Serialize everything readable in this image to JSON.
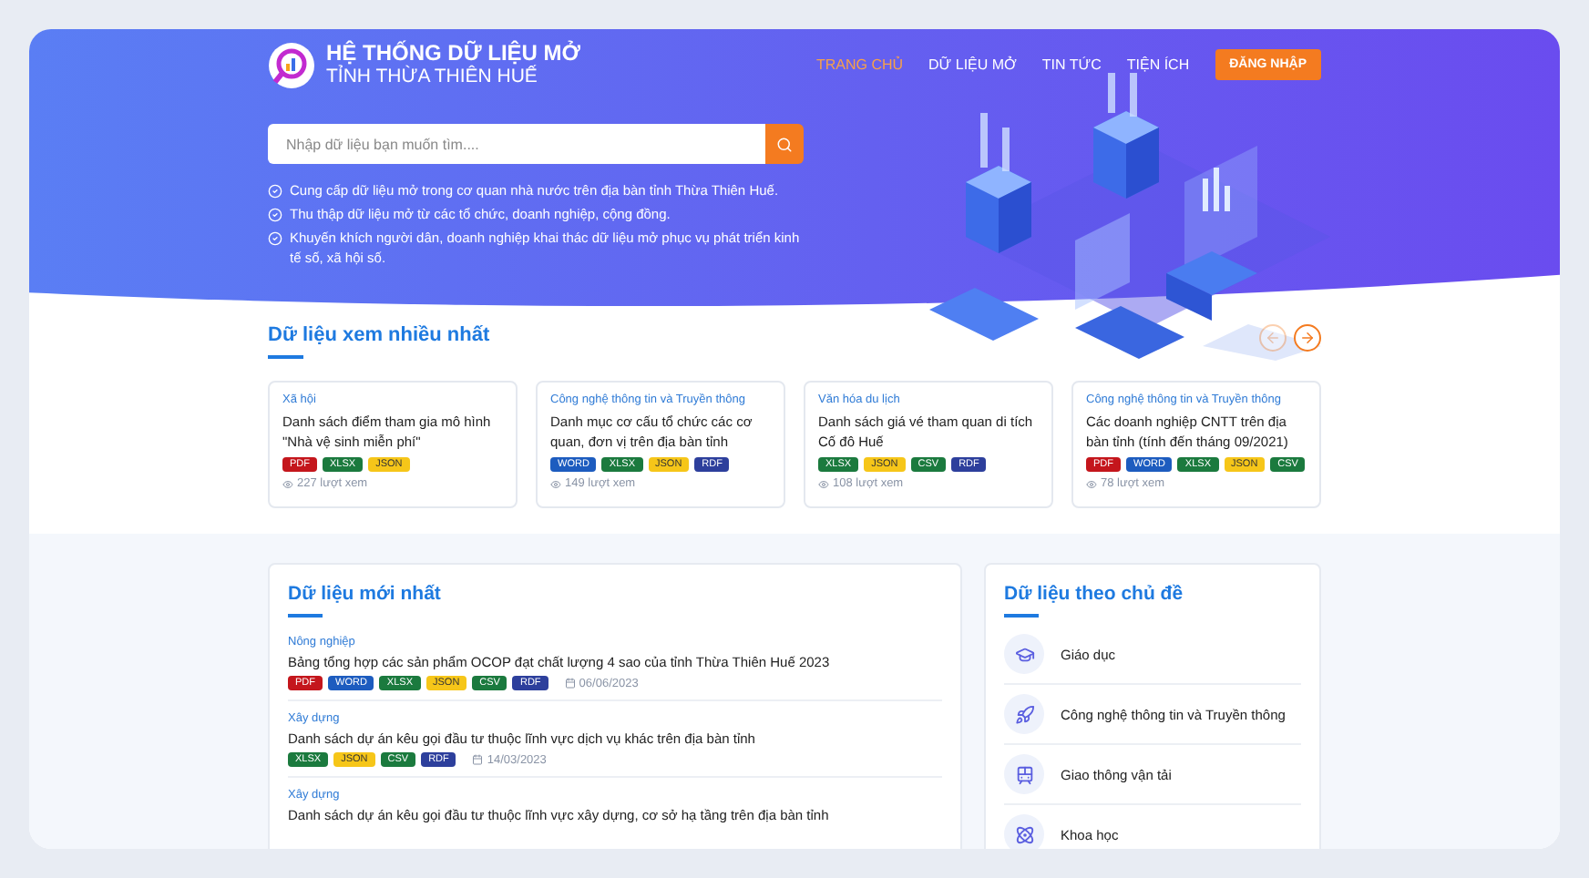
{
  "header": {
    "logo_title": "HỆ THỐNG DỮ LIỆU MỞ",
    "logo_subtitle": "TỈNH THỪA THIÊN HUẾ",
    "nav": [
      {
        "label": "TRANG CHỦ",
        "selected": true
      },
      {
        "label": "DỮ LIỆU MỞ",
        "selected": false
      },
      {
        "label": "TIN TỨC",
        "selected": false
      },
      {
        "label": "TIỆN ÍCH",
        "selected": false
      }
    ],
    "login_button": "ĐĂNG NHẬP"
  },
  "search": {
    "placeholder": "Nhập dữ liệu bạn muốn tìm...."
  },
  "bullets": [
    "Cung cấp dữ liệu mở trong cơ quan nhà nước trên địa bàn tỉnh Thừa Thiên Huế.",
    "Thu thập dữ liệu mở từ các tổ chức, doanh nghiệp, cộng đồng.",
    "Khuyến khích người dân, doanh nghiệp khai thác dữ liệu mở phục vụ phát triển kinh tế số, xã hội số."
  ],
  "most_viewed": {
    "title": "Dữ liệu xem nhiều nhất",
    "arrows": [
      {
        "kind": "prev",
        "disabled": true
      },
      {
        "kind": "next",
        "disabled": false
      }
    ],
    "cards": [
      {
        "category": "Xã hội",
        "title": "Danh sách điểm tham gia mô hình \"Nhà vệ sinh miễn phí\"",
        "tags": [
          {
            "label": "PDF",
            "color": "#c4161c"
          },
          {
            "label": "XLSX",
            "color": "#1b7a3e"
          },
          {
            "label": "JSON",
            "color": "#f6c619"
          }
        ],
        "views": "227 lượt xem"
      },
      {
        "category": "Công nghệ thông tin và Truyền thông",
        "title": "Danh mục cơ cấu tổ chức các cơ quan, đơn vị trên địa bàn tỉnh",
        "tags": [
          {
            "label": "WORD",
            "color": "#1d5cbf"
          },
          {
            "label": "XLSX",
            "color": "#1b7a3e"
          },
          {
            "label": "JSON",
            "color": "#f6c619"
          },
          {
            "label": "RDF",
            "color": "#2d3f9c"
          }
        ],
        "views": "149 lượt xem"
      },
      {
        "category": "Văn hóa du lịch",
        "title": "Danh sách giá vé tham quan di tích Cố đô Huế",
        "tags": [
          {
            "label": "XLSX",
            "color": "#1b7a3e"
          },
          {
            "label": "JSON",
            "color": "#f6c619"
          },
          {
            "label": "CSV",
            "color": "#1b7a3e"
          },
          {
            "label": "RDF",
            "color": "#2d3f9c"
          }
        ],
        "views": "108 lượt xem"
      },
      {
        "category": "Công nghệ thông tin và Truyền thông",
        "title": "Các doanh nghiệp CNTT trên địa bàn tỉnh (tính đến tháng 09/2021)",
        "tags": [
          {
            "label": "PDF",
            "color": "#c4161c"
          },
          {
            "label": "WORD",
            "color": "#1d5cbf"
          },
          {
            "label": "XLSX",
            "color": "#1b7a3e"
          },
          {
            "label": "JSON",
            "color": "#f6c619"
          },
          {
            "label": "CSV",
            "color": "#1b7a3e"
          }
        ],
        "views": "78 lượt xem"
      }
    ]
  },
  "latest": {
    "title": "Dữ liệu mới nhất",
    "items": [
      {
        "category": "Nông nghiệp",
        "title": "Bảng tổng hợp các sản phẩm OCOP đạt chất lượng 4 sao của tỉnh Thừa Thiên Huế 2023",
        "tags": [
          {
            "label": "PDF",
            "color": "#c4161c"
          },
          {
            "label": "WORD",
            "color": "#1d5cbf"
          },
          {
            "label": "XLSX",
            "color": "#1b7a3e"
          },
          {
            "label": "JSON",
            "color": "#f6c619"
          },
          {
            "label": "CSV",
            "color": "#1b7a3e"
          },
          {
            "label": "RDF",
            "color": "#2d3f9c"
          }
        ],
        "date": "06/06/2023"
      },
      {
        "category": "Xây dựng",
        "title": "Danh sách dự án kêu gọi đầu tư thuộc lĩnh vực dịch vụ khác trên địa bàn tỉnh",
        "tags": [
          {
            "label": "XLSX",
            "color": "#1b7a3e"
          },
          {
            "label": "JSON",
            "color": "#f6c619"
          },
          {
            "label": "CSV",
            "color": "#1b7a3e"
          },
          {
            "label": "RDF",
            "color": "#2d3f9c"
          }
        ],
        "date": "14/03/2023"
      },
      {
        "category": "Xây dựng",
        "title": "Danh sách dự án kêu gọi đầu tư thuộc lĩnh vực xây dựng, cơ sở hạ tầng trên địa bàn tỉnh"
      }
    ]
  },
  "topics": {
    "title": "Dữ liệu theo chủ đề",
    "items": [
      {
        "kind": "education",
        "label": "Giáo dục"
      },
      {
        "kind": "technology",
        "label": "Công nghệ thông tin và Truyền thông"
      },
      {
        "kind": "transport",
        "label": "Giao thông vận tải"
      },
      {
        "kind": "science",
        "label": "Khoa học"
      }
    ]
  }
}
